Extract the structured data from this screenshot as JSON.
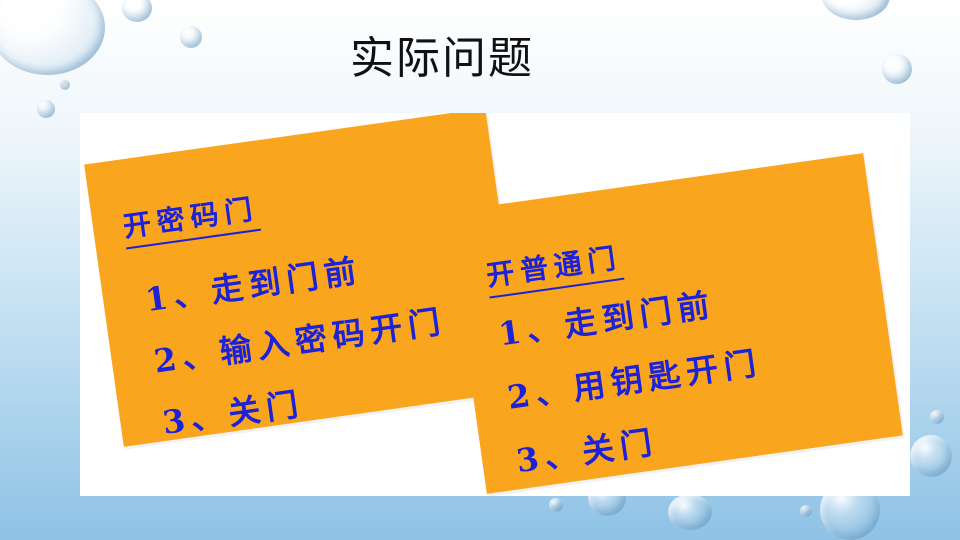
{
  "slide": {
    "title": "实际问题"
  },
  "card_left": {
    "title": "开密码门",
    "steps": [
      "1、走到门前",
      "2、输入密码开门",
      "3、关门"
    ]
  },
  "card_right": {
    "title": "开普通门",
    "steps": [
      "1、走到门前",
      "2、用钥匙开门",
      "3、关门"
    ]
  },
  "colors": {
    "card": "#f9a61e",
    "text": "#1e22d6",
    "background_top": "#ffffff",
    "background_bottom": "#8ec2e6"
  }
}
